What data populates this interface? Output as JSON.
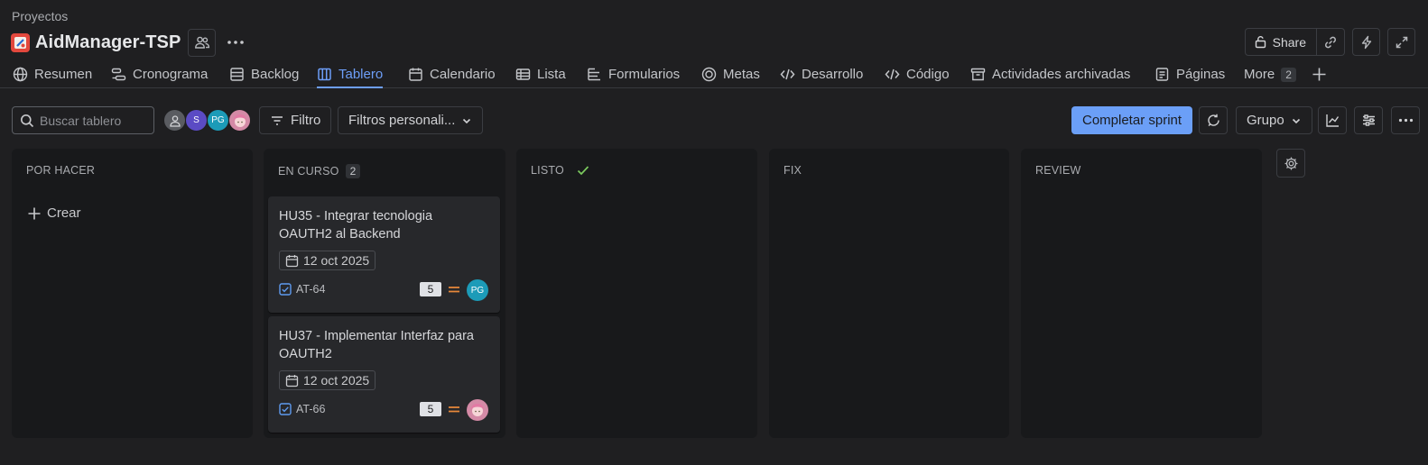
{
  "header": {
    "breadcrumb": "Proyectos",
    "project_name": "AidManager-TSP",
    "share_label": "Share"
  },
  "tabs": [
    {
      "label": "Resumen",
      "icon": "globe-icon"
    },
    {
      "label": "Cronograma",
      "icon": "timeline-icon"
    },
    {
      "label": "Backlog",
      "icon": "backlog-icon"
    },
    {
      "label": "Tablero",
      "icon": "board-icon",
      "active": true
    },
    {
      "label": "Calendario",
      "icon": "calendar-icon"
    },
    {
      "label": "Lista",
      "icon": "list-icon"
    },
    {
      "label": "Formularios",
      "icon": "forms-icon"
    },
    {
      "label": "Metas",
      "icon": "goals-icon"
    },
    {
      "label": "Desarrollo",
      "icon": "code-icon"
    },
    {
      "label": "Código",
      "icon": "code-icon"
    },
    {
      "label": "Actividades archivadas",
      "icon": "archive-icon"
    },
    {
      "label": "Páginas",
      "icon": "pages-icon"
    },
    {
      "label": "More",
      "count": "2"
    }
  ],
  "toolbar": {
    "search_placeholder": "Buscar tablero",
    "avatars": [
      {
        "initials": "",
        "color": "#5a5c61"
      },
      {
        "initials": "S",
        "color": "#5b4bc4"
      },
      {
        "initials": "PG",
        "color": "#1c9bb8"
      },
      {
        "initials": "",
        "color": "#d48aa6"
      }
    ],
    "filter_label": "Filtro",
    "custom_filters_label": "Filtros personali...",
    "complete_sprint_label": "Completar sprint",
    "group_label": "Grupo"
  },
  "columns": [
    {
      "title": "POR HACER",
      "create_label": "Crear"
    },
    {
      "title": "EN CURSO",
      "count": "2"
    },
    {
      "title": "LISTO"
    },
    {
      "title": "FIX"
    },
    {
      "title": "REVIEW"
    }
  ],
  "cards": [
    {
      "title": "HU35 - Integrar tecnologia OAUTH2 al Backend",
      "date": "12 oct 2025",
      "key": "AT-64",
      "estimate": "5",
      "assignee": "PG",
      "assignee_color": "#1c9bb8",
      "priority": "medium"
    },
    {
      "title": "HU37 - Implementar Interfaz para OAUTH2",
      "date": "12 oct 2025",
      "key": "AT-66",
      "estimate": "5",
      "assignee": "",
      "assignee_color": "#d48aa6",
      "priority": "medium"
    }
  ],
  "colors": {
    "accent": "#6d9ef8",
    "primary_button": "#6b9ff7",
    "priority_medium": "#e8883a",
    "done_check": "#7bc95e",
    "task_icon": "#5e9bf0"
  }
}
